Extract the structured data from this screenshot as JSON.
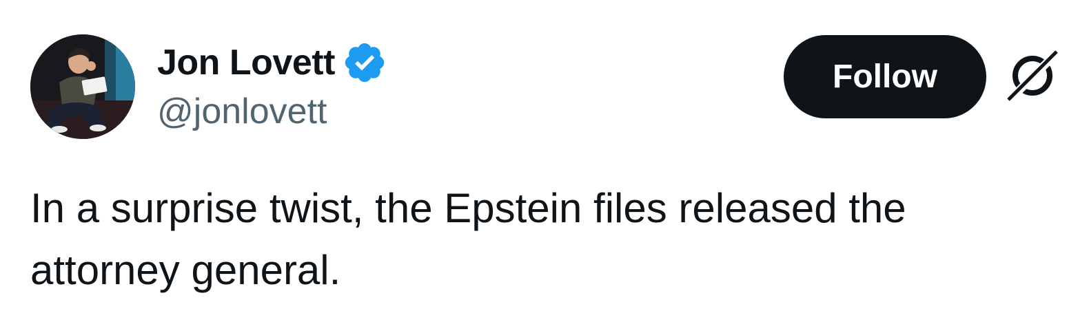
{
  "author": {
    "display_name": "Jon Lovett",
    "handle": "@jonlovett",
    "verified": true,
    "avatar_icon": "profile-photo"
  },
  "actions": {
    "follow_label": "Follow",
    "grok_icon": "grok-icon"
  },
  "tweet": {
    "text": "In a surprise twist, the Epstein files released the attorney general."
  },
  "colors": {
    "text_primary": "#0f1419",
    "text_secondary": "#536471",
    "verified_blue": "#1d9bf0",
    "follow_bg": "#0f1419",
    "follow_fg": "#ffffff",
    "background": "#ffffff"
  }
}
